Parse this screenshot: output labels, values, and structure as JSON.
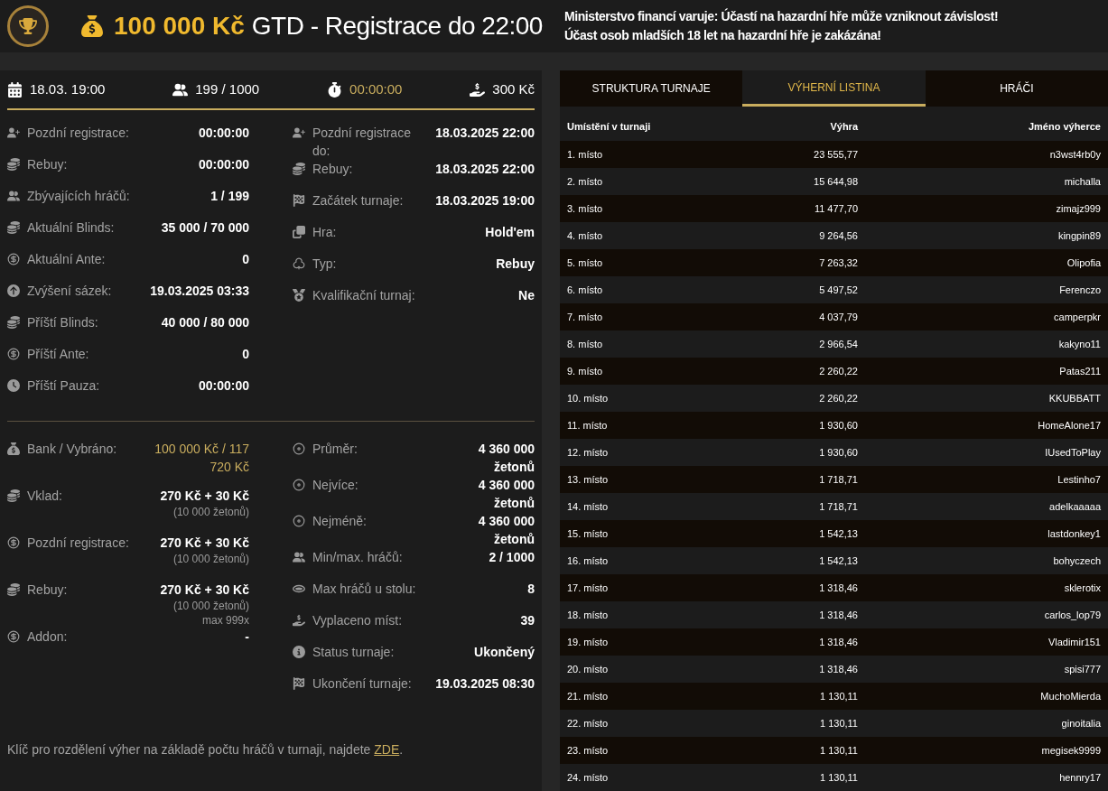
{
  "header": {
    "prize": "100 000 Kč",
    "title": "GTD - Registrace do 22:00",
    "warning": [
      "Ministerstvo financí varuje: Účastí na hazardní hře může vzniknout závislost!",
      "Účast osob mladších 18 let na hazardní hře je zakázána!"
    ]
  },
  "summary": [
    {
      "text": "18.03. 19:00",
      "highlight": false
    },
    {
      "text": "199 / 1000",
      "highlight": false
    },
    {
      "text": "00:00:00",
      "highlight": true
    },
    {
      "text": "300 Kč",
      "highlight": false
    }
  ],
  "details": {
    "left": [
      {
        "label": "Pozdní registrace:",
        "value": "00:00:00"
      },
      {
        "label": "Rebuy:",
        "value": "00:00:00"
      },
      {
        "label": "Zbývajících hráčů:",
        "value": "1 / 199"
      },
      {
        "label": "Aktuální Blinds:",
        "value": "35 000 / 70 000"
      },
      {
        "label": "Aktuální Ante:",
        "value": "0"
      },
      {
        "label": "Zvýšení sázek:",
        "value": "19.03.2025 03:33"
      },
      {
        "label": "Příští Blinds:",
        "value": "40 000 / 80 000"
      },
      {
        "label": "Příští Ante:",
        "value": "0"
      },
      {
        "label": "Příští Pauza:",
        "value": "00:00:00"
      }
    ],
    "right": [
      {
        "label": "Pozdní registrace do:",
        "value": "18.03.2025 22:00"
      },
      {
        "label": "Rebuy:",
        "value": "18.03.2025 22:00"
      },
      {
        "label": "Začátek turnaje:",
        "value": "18.03.2025 19:00"
      },
      {
        "label": "Hra:",
        "value": "Hold'em"
      },
      {
        "label": "Typ:",
        "value": "Rebuy"
      },
      {
        "label": "Kvalifikační turnaj:",
        "value": "Ne"
      }
    ]
  },
  "funds": {
    "left": [
      {
        "label": "Bank / Vybráno:",
        "value": "100 000 Kč / 117 720 Kč",
        "accent": true
      },
      {
        "label": "Vklad:",
        "value": "270 Kč + 30 Kč",
        "note": "(10 000 žetonů)",
        "accent": false
      },
      {
        "label": "Pozdní registrace:",
        "value": "270 Kč + 30 Kč",
        "note": "(10 000 žetonů)",
        "accent": false
      },
      {
        "label": "Rebuy:",
        "value": "270 Kč + 30 Kč",
        "note": "(10 000 žetonů) max 999x",
        "accent": false
      },
      {
        "label": "Addon:",
        "value": "-",
        "accent": false
      }
    ],
    "right": [
      {
        "label": "Průměr:",
        "value": "4 360 000 žetonů"
      },
      {
        "label": "Nejvíce:",
        "value": "4 360 000 žetonů"
      },
      {
        "label": "Nejméně:",
        "value": "4 360 000 žetonů"
      },
      {
        "label": "Min/max. hráčů:",
        "value": "2 / 1000"
      },
      {
        "label": "Max hráčů u stolu:",
        "value": "8"
      },
      {
        "label": "Vyplaceno míst:",
        "value": "39"
      },
      {
        "label": "Status turnaje:",
        "value": "Ukončený"
      },
      {
        "label": "Ukončení turnaje:",
        "value": "19.03.2025 08:30"
      }
    ]
  },
  "footer": {
    "text": "Klíč pro rozdělení výher na základě počtu hráčů v turnaji, najdete",
    "link": "ZDE",
    "after": "."
  },
  "tabs": [
    {
      "label": "STRUKTURA TURNAJE",
      "selected": false
    },
    {
      "label": "VÝHERNÍ LISTINA",
      "selected": true
    },
    {
      "label": "HRÁČI",
      "selected": false
    }
  ],
  "table": {
    "columns": [
      "Umístění v turnaji",
      "Výhra",
      "Jméno výherce"
    ],
    "rows": [
      [
        "1. místo",
        "23 555,77",
        "n3wst4rb0y"
      ],
      [
        "2. místo",
        "15 644,98",
        "michalla"
      ],
      [
        "3. místo",
        "11 477,70",
        "zimajz999"
      ],
      [
        "4. místo",
        "9 264,56",
        "kingpin89"
      ],
      [
        "5. místo",
        "7 263,32",
        "Olipofia"
      ],
      [
        "6. místo",
        "5 497,52",
        "Ferenczo"
      ],
      [
        "7. místo",
        "4 037,79",
        "camperpkr"
      ],
      [
        "8. místo",
        "2 966,54",
        "kakyno11"
      ],
      [
        "9. místo",
        "2 260,22",
        "Patas211"
      ],
      [
        "10. místo",
        "2 260,22",
        "KKUBBATT"
      ],
      [
        "11. místo",
        "1 930,60",
        "HomeAlone17"
      ],
      [
        "12. místo",
        "1 930,60",
        "IUsedToPlay"
      ],
      [
        "13. místo",
        "1 718,71",
        "Lestinho7"
      ],
      [
        "14. místo",
        "1 718,71",
        "adelkaaaaa"
      ],
      [
        "15. místo",
        "1 542,13",
        "lastdonkey1"
      ],
      [
        "16. místo",
        "1 542,13",
        "bohyczech"
      ],
      [
        "17. místo",
        "1 318,46",
        "sklerotix"
      ],
      [
        "18. místo",
        "1 318,46",
        "carlos_lop79"
      ],
      [
        "19. místo",
        "1 318,46",
        "Vladimir151"
      ],
      [
        "20. místo",
        "1 318,46",
        "spisi777"
      ],
      [
        "21. místo",
        "1 130,11",
        "MuchoMierda"
      ],
      [
        "22. místo",
        "1 130,11",
        "ginoitalia"
      ],
      [
        "23. místo",
        "1 130,11",
        "megisek9999"
      ],
      [
        "24. místo",
        "1 130,11",
        "hennry17"
      ]
    ]
  }
}
